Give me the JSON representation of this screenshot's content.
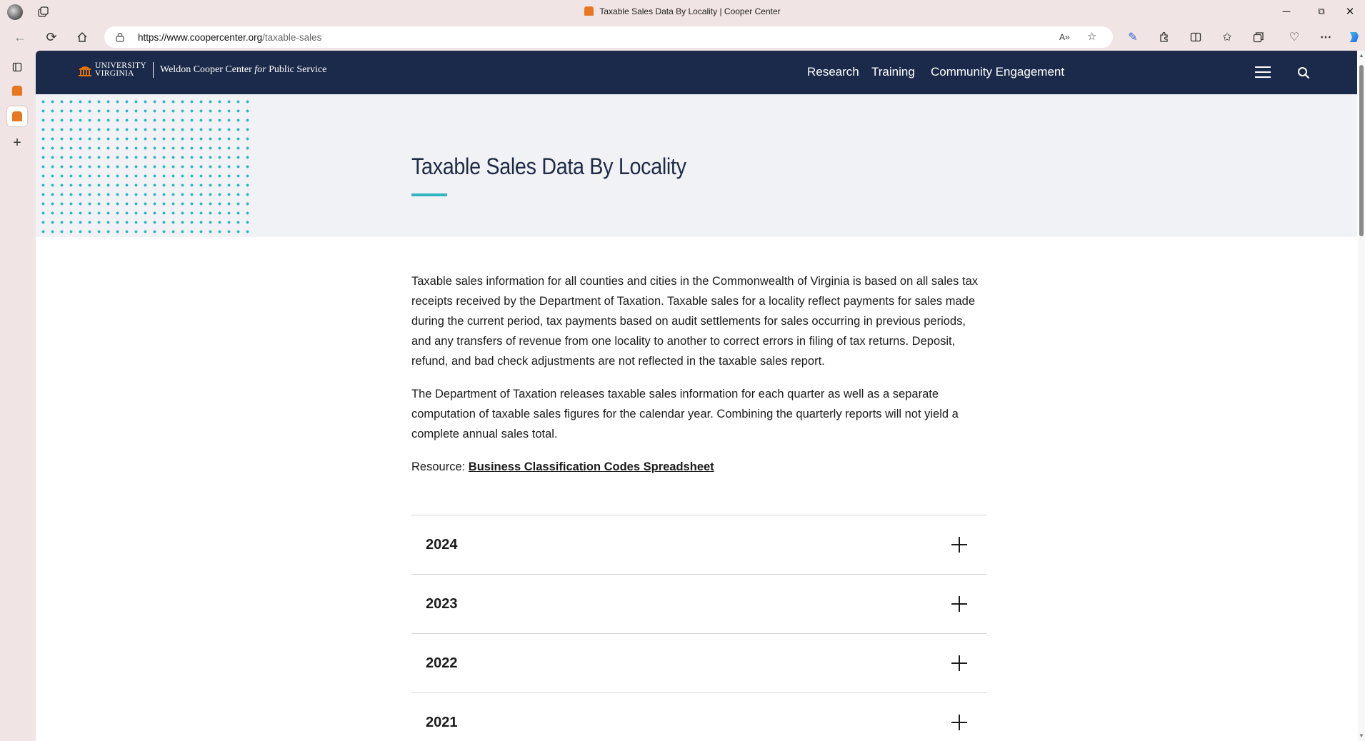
{
  "browser": {
    "window_title": "Taxable Sales Data By Locality | Cooper Center",
    "url_host": "https://www.coopercenter.org",
    "url_path": "/taxable-sales",
    "window_controls": {
      "minimize": "─",
      "restore": "⧉",
      "close": "✕"
    },
    "read_aloud_label": "A»"
  },
  "site": {
    "logo_university_line1": "UNIVERSITY",
    "logo_university_line2": "VIRGINIA",
    "logo_center_pre": "Weldon Cooper Center",
    "logo_center_for": "for",
    "logo_center_post": "Public Service",
    "nav": {
      "research": "Research",
      "training": "Training",
      "community": "Community Engagement"
    },
    "brand_colors": {
      "header": "#1b2a4a",
      "accent": "#2fb6c1"
    }
  },
  "page": {
    "title": "Taxable Sales Data By Locality",
    "paragraph1": "Taxable sales information for all counties and cities in the Commonwealth of Virginia is based on all sales tax receipts received by the Department of Taxation. Taxable sales for a locality reflect payments for sales made during the current period, tax payments based on audit settlements for sales occurring in previous periods, and any transfers of revenue from one locality to another to correct errors in filing of tax returns. Deposit, refund, and bad check adjustments are not reflected in the taxable sales report.",
    "paragraph2": "The Department of Taxation releases taxable sales information for each quarter as well as a separate computation of taxable sales figures for the calendar year. Combining the quarterly reports will not yield a complete annual sales total.",
    "resource_label": "Resource:",
    "resource_link": "Business Classification Codes Spreadsheet",
    "accordion": [
      "2024",
      "2023",
      "2022",
      "2021"
    ]
  }
}
